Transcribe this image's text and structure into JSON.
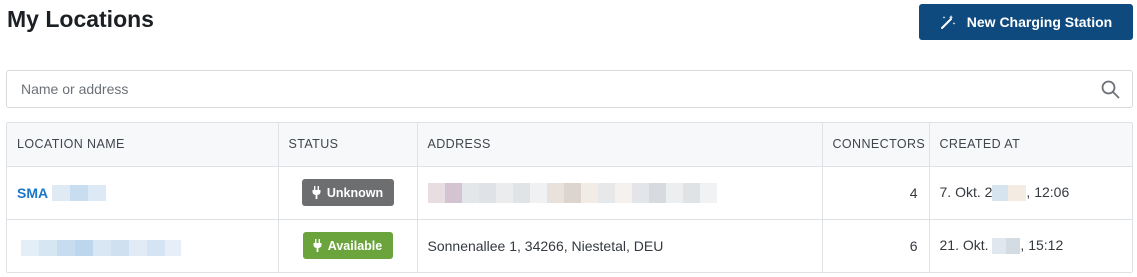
{
  "header": {
    "title": "My Locations",
    "new_button_label": "New Charging Station"
  },
  "search": {
    "placeholder": "Name or address",
    "value": ""
  },
  "table": {
    "columns": [
      "LOCATION NAME",
      "STATUS",
      "ADDRESS",
      "CONNECTORS",
      "CREATED AT"
    ],
    "rows": [
      {
        "name": "SMA",
        "status": "Unknown",
        "address": "",
        "connectors": "4",
        "created_prefix": "7. Okt. 2",
        "created_suffix": ", 12:06"
      },
      {
        "name": "",
        "status": "Available",
        "address": "Sonnenallee 1, 34266, Niestetal, DEU",
        "connectors": "6",
        "created_prefix": "21. Okt.",
        "created_suffix": ", 15:12"
      }
    ]
  },
  "colors": {
    "primary_button": "#0f4a7e",
    "link": "#1a77c9",
    "status_unknown": "#6c6e70",
    "status_available": "#6ba33c"
  },
  "icons": {
    "new_button": "magic-wand-icon",
    "search": "search-icon",
    "status": "plug-icon"
  }
}
